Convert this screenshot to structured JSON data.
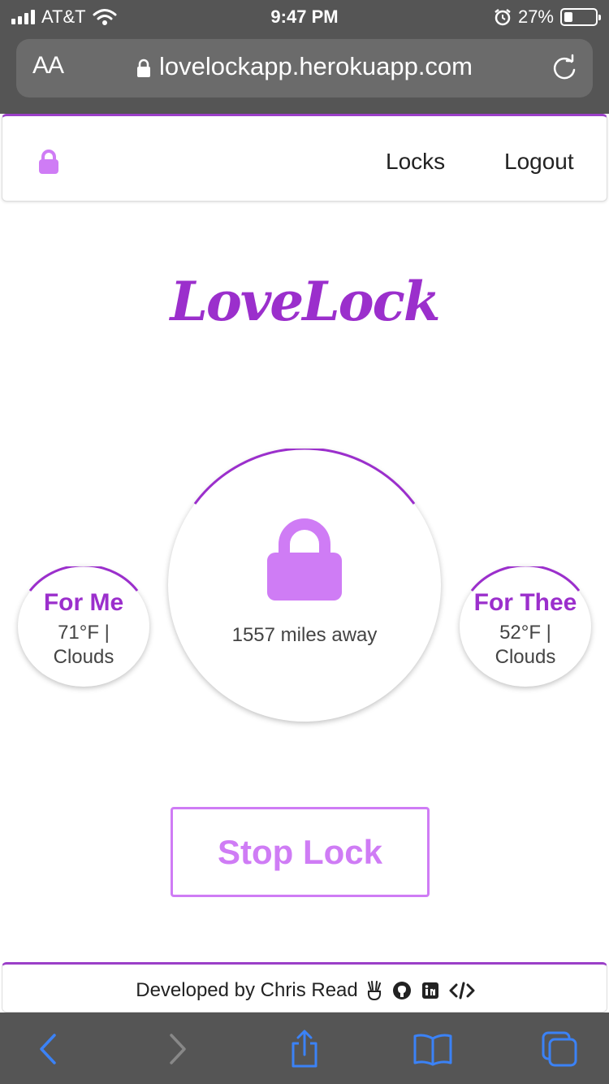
{
  "status_bar": {
    "carrier": "AT&T",
    "time": "9:47 PM",
    "battery_percent": "27%",
    "battery_level": 0.27
  },
  "browser": {
    "text_size_label": "AA",
    "url": "lovelockapp.herokuapp.com"
  },
  "nav": {
    "brand_icon": "lock-icon",
    "links": [
      {
        "label": "Locks"
      },
      {
        "label": "Logout"
      }
    ]
  },
  "logo": {
    "text": "LoveLock"
  },
  "main": {
    "center": {
      "icon": "lock-icon",
      "distance": "1557 miles away"
    },
    "for_me": {
      "title": "For Me",
      "temperature": "71°F |",
      "condition": "Clouds"
    },
    "for_thee": {
      "title": "For Thee",
      "temperature": "52°F |",
      "condition": "Clouds"
    },
    "stop_button_label": "Stop Lock"
  },
  "footer": {
    "credit": "Developed by Chris Read",
    "icons": [
      "angellist-icon",
      "github-icon",
      "linkedin-icon",
      "code-icon"
    ]
  },
  "toolbar": {
    "icons": [
      "back-icon",
      "forward-icon",
      "share-icon",
      "bookmarks-icon",
      "tabs-icon"
    ]
  },
  "colors": {
    "accent": "#9b2fcc",
    "lock": "#cf7cf5",
    "chrome": "#555555",
    "toolbar_blue": "#3b82f6"
  }
}
